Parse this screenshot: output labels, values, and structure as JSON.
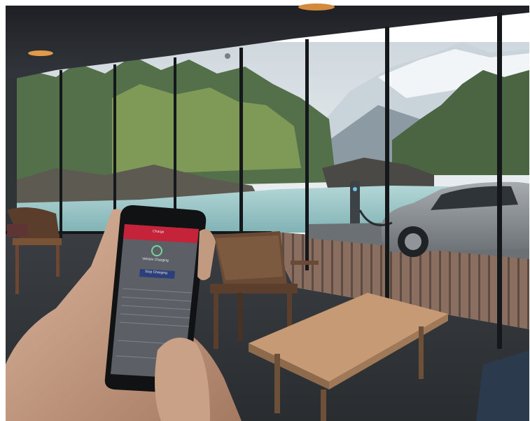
{
  "photo": {
    "subject": "hand-holding-phone-with-car-charging-app",
    "colors": {
      "ceiling": "#2a2d33",
      "sky": "#dfe6ea",
      "floor": "#33373b",
      "deck": "#8a6f60",
      "water": "#9cc7c9",
      "app_header": "#c4233a",
      "app_body": "#5c6066",
      "car": "#8d9296"
    }
  },
  "phone_app": {
    "header_title": "Charge",
    "status_text": "Vehicle Charging",
    "primary_button": "Stop Charging",
    "rows": [
      "",
      "",
      "",
      "",
      ""
    ],
    "sections": [
      "",
      "",
      ""
    ]
  }
}
